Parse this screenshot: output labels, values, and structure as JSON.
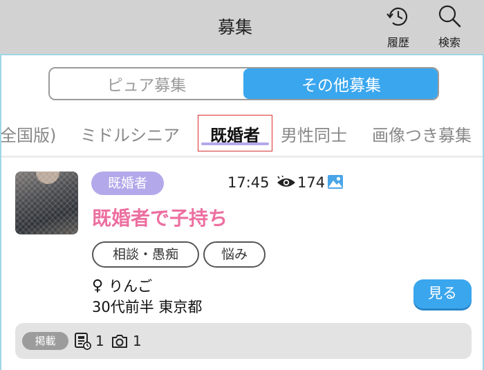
{
  "header": {
    "title": "募集",
    "history_label": "履歴",
    "search_label": "検索"
  },
  "segment": {
    "options": [
      "ピュア募集",
      "その他募集"
    ],
    "selected": "その他募集"
  },
  "tabs": {
    "items": [
      "全国版)",
      "ミドルシニア",
      "既婚者",
      "男性同士",
      "画像つき募集"
    ],
    "selected": "既婚者"
  },
  "post": {
    "category": "既婚者",
    "time": "17:45",
    "views": "174",
    "title": "既婚者で子持ち",
    "tags": [
      "相談・愚痴",
      "悩み"
    ],
    "gender_symbol": "♀",
    "author": "りんご",
    "profile": "30代前半 東京都",
    "view_button": "見る",
    "footer": {
      "posted_label": "掲載",
      "doc_count": "1",
      "photo_count": "1"
    }
  },
  "colors": {
    "accent_blue": "#3aa6ee",
    "category_purple": "#b3a9ea",
    "title_pink": "#ec6fa0",
    "header_gray": "#d2d2d2"
  },
  "icons": [
    "history-icon",
    "search-icon",
    "eye-icon",
    "image-icon",
    "document-icon",
    "camera-icon"
  ]
}
